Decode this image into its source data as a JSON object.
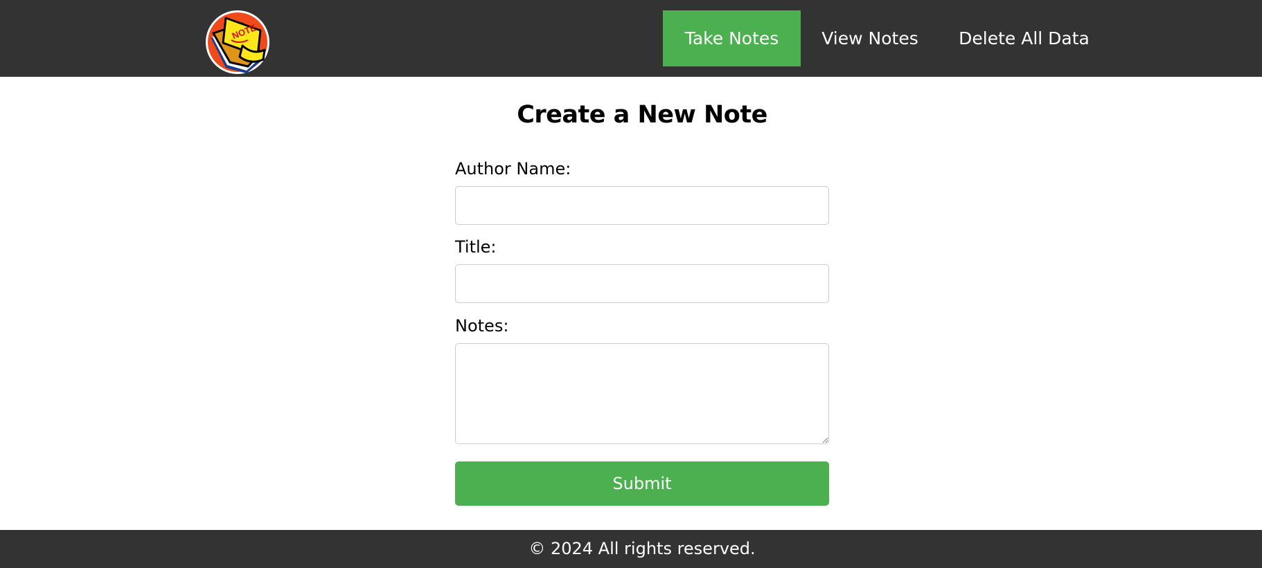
{
  "header": {
    "logo_text": "NOTE",
    "nav": [
      {
        "label": "Take Notes",
        "active": true
      },
      {
        "label": "View Notes",
        "active": false
      },
      {
        "label": "Delete All Data",
        "active": false
      }
    ]
  },
  "form": {
    "title": "Create a New Note",
    "author_label": "Author Name:",
    "author_value": "",
    "title_label": "Title:",
    "title_value": "",
    "notes_label": "Notes:",
    "notes_value": "",
    "submit_label": "Submit"
  },
  "footer": {
    "text": "© 2024 All rights reserved."
  },
  "colors": {
    "header_bg": "#333333",
    "accent": "#4caf50",
    "footer_bg": "#333333"
  }
}
